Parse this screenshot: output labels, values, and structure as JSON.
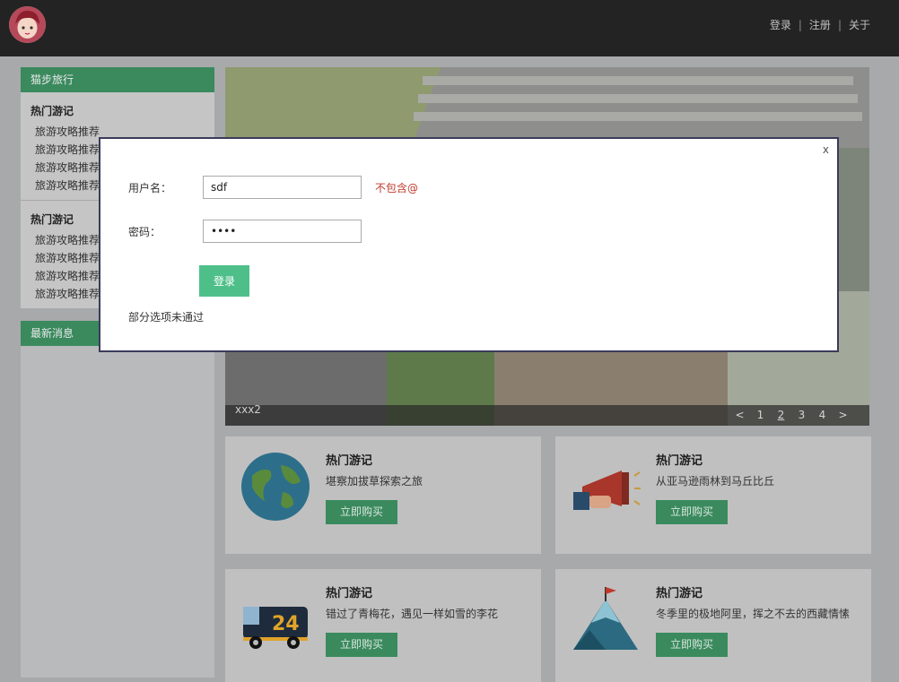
{
  "header": {
    "nav": [
      "登录",
      "注册",
      "关于"
    ],
    "separator": "|"
  },
  "sidebar": {
    "title": "猫步旅行",
    "sections": [
      {
        "title": "热门游记",
        "items": [
          "旅游攻略推荐",
          "旅游攻略推荐",
          "旅游攻略推荐",
          "旅游攻略推荐"
        ]
      },
      {
        "title": "热门游记",
        "items": [
          "旅游攻略推荐",
          "旅游攻略推荐",
          "旅游攻略推荐",
          "旅游攻略推荐"
        ]
      }
    ],
    "news_title": "最新消息"
  },
  "banner": {
    "caption": "xxx2",
    "pager": [
      "<",
      "1",
      "2",
      "3",
      "4",
      ">"
    ],
    "active_page": "2"
  },
  "cards": [
    {
      "title": "热门游记",
      "desc": "堪察加拔草探索之旅",
      "button": "立即购买",
      "icon": "globe-icon"
    },
    {
      "title": "热门游记",
      "desc": "从亚马逊雨林到马丘比丘",
      "button": "立即购买",
      "icon": "megaphone-icon"
    },
    {
      "title": "热门游记",
      "desc": "错过了青梅花，遇见一样如雪的李花",
      "button": "立即购买",
      "icon": "delivery-truck-icon"
    },
    {
      "title": "热门游记",
      "desc": "冬季里的极地阿里，挥之不去的西藏情愫",
      "button": "立即购买",
      "icon": "mountain-flag-icon"
    }
  ],
  "modal": {
    "close": "x",
    "username_label": "用户名：",
    "username_value": "sdf",
    "username_error": "不包含@",
    "password_label": "密码：",
    "password_value": "1234",
    "login_button": "登录",
    "message": "部分选项未通过"
  },
  "colors": {
    "header_bg": "#232323",
    "accent_green": "#4fbf8a",
    "error_red": "#c0392b"
  }
}
